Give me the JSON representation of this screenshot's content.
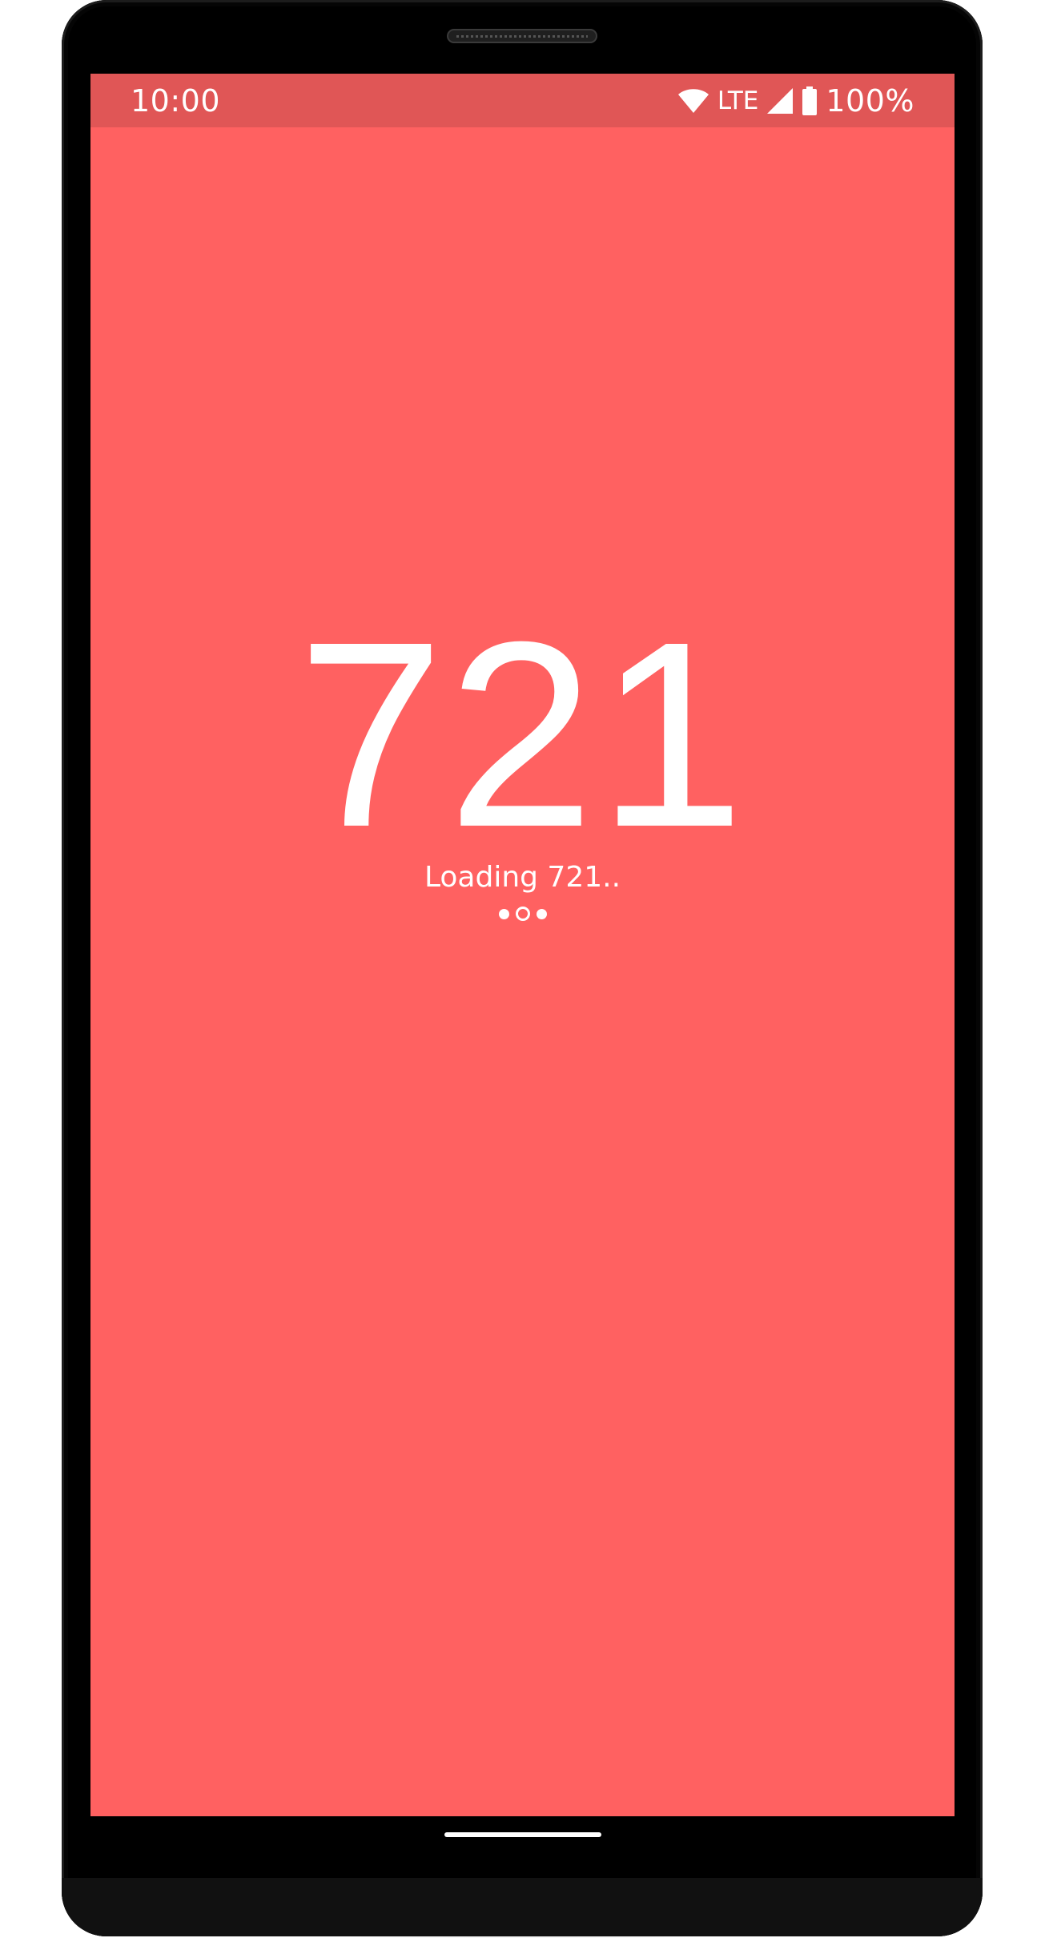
{
  "status_bar": {
    "time": "10:00",
    "network": "LTE",
    "battery": "100%",
    "icons": [
      "wifi-icon",
      "cell-signal-icon",
      "battery-icon"
    ]
  },
  "main": {
    "number": "721",
    "loading_text": "Loading 721..",
    "indicator": {
      "dots": 3,
      "active_index": 1
    }
  },
  "colors": {
    "background": "#ff6161",
    "status_bar": "#e05656",
    "foreground": "#ffffff"
  }
}
